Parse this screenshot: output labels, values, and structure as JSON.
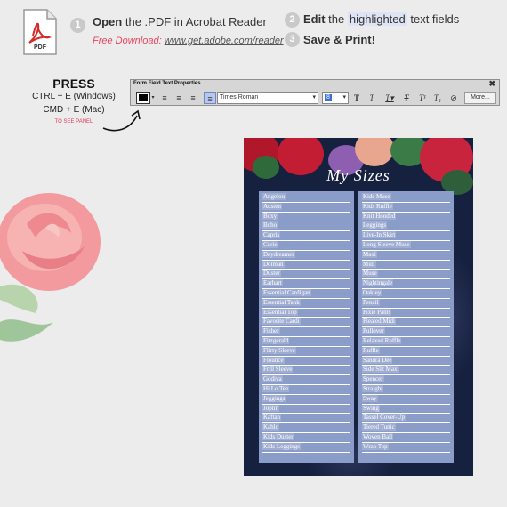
{
  "header": {
    "pdf_icon_label": "PDF",
    "step1": {
      "number": "1",
      "bold": "Open",
      "rest": " the .PDF in Acrobat Reader"
    },
    "download_label": "Free Download:",
    "download_url": "www.get.adobe.com/reader",
    "step2": {
      "number": "2",
      "bold": "Edit",
      "pre": " the ",
      "highlight": "highlighted",
      "post": " text fields"
    },
    "step3": {
      "number": "3",
      "bold": "Save & Print!"
    }
  },
  "press": {
    "title": "PRESS",
    "line1": "CTRL + E (Windows)",
    "line2": "CMD + E (Mac)",
    "note": "TO SEE PANEL"
  },
  "toolbar": {
    "title": "Form Field Text Properties",
    "close": "✖",
    "font": "Times Roman",
    "size": "8",
    "more_label": "More..."
  },
  "document": {
    "title": "My Sizes",
    "left_items": [
      "Angelou",
      "Austen",
      "Boxy",
      "Boho",
      "Capris",
      "Curie",
      "Daydreamer",
      "Dolman",
      "Duster",
      "Earhart",
      "Essential Cardigan",
      "Essential Tank",
      "Essential Top",
      "Favorite Cardi",
      "Fisher",
      "Fitzgerald",
      "Flirty Sleeve",
      "Flounce",
      "Frill Sleeve",
      "Godiva",
      "Hi Lo Tee",
      "Jeggings",
      "Joplin",
      "Kaftan",
      "Kahlo",
      "Kids Duster",
      "Kids Leggings"
    ],
    "right_items": [
      "Kids Muse",
      "Kids Ruffle",
      "Knit Hooded",
      "Leggings",
      "Live-In Skirt",
      "Long Sleeve Muse",
      "Maxi",
      "Midi",
      "Muse",
      "Nightingale",
      "Oakley",
      "Pencil",
      "Pixie Pants",
      "Pleated Midi",
      "Pullover",
      "Relaxed Ruffle",
      "Ruffle",
      "Sandra Dee",
      "Side Slit Maxi",
      "Spencer",
      "Straight",
      "Sway",
      "Swing",
      "Tassel Cover-Up",
      "Tiered Tunic",
      "Woven Ball",
      "Wrap Top"
    ]
  }
}
